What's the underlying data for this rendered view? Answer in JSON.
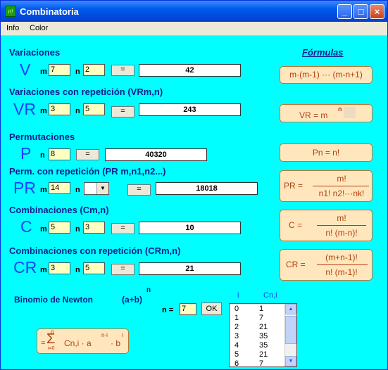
{
  "window": {
    "title": "Combinatoria"
  },
  "menu": [
    "Info",
    "Color"
  ],
  "formulas_title": "Fórmulas",
  "variaciones": {
    "title": "Variaciones",
    "symbol": "V",
    "m": "7",
    "n": "2",
    "btn": "=",
    "result": "42",
    "formula": "m·(m-1) ··· (m-n+1)"
  },
  "variaciones_rep": {
    "title": "Variaciones con repetición (VRm,n)",
    "symbol": "VR",
    "m": "3",
    "n": "5",
    "btn": "=",
    "result": "243",
    "formula_lhs": "VR = m",
    "formula_exp": "n"
  },
  "permutaciones": {
    "title": "Permutaciones",
    "symbol": "P",
    "n": "8",
    "btn": "=",
    "result": "40320",
    "formula": "Pn = n!"
  },
  "perm_rep": {
    "title": "Perm. con repetición (PR m,n1,n2...)",
    "symbol": "PR",
    "m": "14",
    "n": "",
    "btn": "=",
    "result": "18018",
    "formula_lhs": "PR =",
    "formula_num": "m!",
    "formula_den": "n1! n2!···nk!"
  },
  "combinaciones": {
    "title": "Combinaciones (Cm,n)",
    "symbol": "C",
    "m": "5",
    "n": "3",
    "btn": "=",
    "result": "10",
    "formula_lhs": "C =",
    "formula_num": "m!",
    "formula_den": "n! (m-n)!"
  },
  "combinaciones_rep": {
    "title": "Combinaciones con repetición (CRm,n)",
    "symbol": "CR",
    "m": "3",
    "n": "5",
    "btn": "=",
    "result": "21",
    "formula_lhs": "CR =",
    "formula_num": "(m+n-1)!",
    "formula_den": "n! (m-1)!"
  },
  "binomio": {
    "title": "Binomio de Newton",
    "expr": "(a+b)",
    "exp": "n",
    "n_label": "n =",
    "n": "7",
    "ok": "OK",
    "col_i": "i",
    "col_c": "Cn,i",
    "rows": [
      [
        "0",
        "1"
      ],
      [
        "1",
        "7"
      ],
      [
        "2",
        "21"
      ],
      [
        "3",
        "35"
      ],
      [
        "4",
        "35"
      ],
      [
        "5",
        "21"
      ],
      [
        "6",
        "7"
      ]
    ],
    "formula_eq": "=",
    "sum_top": "n",
    "sum_sigma": "Σ",
    "sum_bottom": "i=0",
    "formula_body": "Cn,i · a",
    "formula_a_exp": "n-i",
    "formula_b": "· b",
    "formula_b_exp": "i"
  }
}
